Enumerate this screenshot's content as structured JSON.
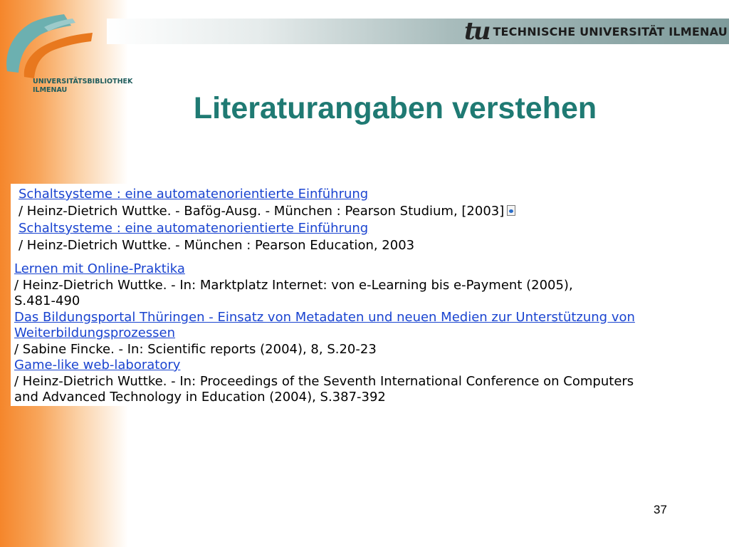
{
  "branding": {
    "library_line1": "UNIVERSITÄTSBIBLIOTHEK",
    "library_line2": "ILMENAU",
    "university_logo": "tu",
    "university_name": "TECHNISCHE UNIVERSITÄT ILMENAU",
    "icons": [
      "library-logo-icon",
      "tu-ilmenau-logo-icon"
    ]
  },
  "slide": {
    "title": "Literaturangaben verstehen",
    "page_number": "37"
  },
  "catalog_entries": [
    {
      "title": "Schaltsysteme : eine automatenorientierte Einführung",
      "details": "/ Heinz-Dietrich Wuttke. - Bafög-Ausg. - München : Pearson Studium, [2003]"
    },
    {
      "title": "Schaltsysteme : eine automatenorientierte Einführung",
      "details": "/ Heinz-Dietrich Wuttke. - München : Pearson Education, 2003"
    }
  ],
  "article_entries": [
    {
      "title": "Lernen mit Online-Praktika",
      "details_line1": "/ Heinz-Dietrich Wuttke. - In: Marktplatz Internet: von e-Learning bis e-Payment (2005),",
      "details_line2": "S.481-490"
    },
    {
      "title_line1": "Das Bildungsportal Thüringen - Einsatz von Metadaten und neuen Medien zur Unterstützung von",
      "title_line2": "Weiterbildungsprozessen",
      "details": "/ Sabine Fincke. - In: Scientific reports (2004), 8, S.20-23"
    },
    {
      "title": "Game-like web-laboratory",
      "details_line1": "/ Heinz-Dietrich Wuttke. - In: Proceedings of the Seventh International Conference on Computers",
      "details_line2": "and Advanced Technology in Education (2004), S.387-392"
    }
  ],
  "colors": {
    "title": "#1f7a73",
    "link": "#1a44d0",
    "accent_orange": "#f5862b",
    "accent_teal": "#5aa8a8"
  }
}
